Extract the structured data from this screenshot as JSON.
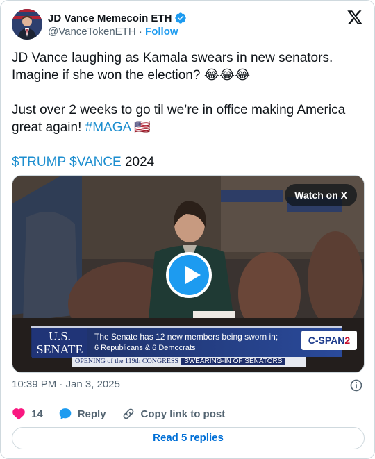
{
  "author": {
    "name": "JD Vance Memecoin ETH",
    "handle": "@VanceTokenETH",
    "separator": "·",
    "follow_label": "Follow"
  },
  "tweet": {
    "line1": "JD Vance laughing as Kamala swears in new senators. Imagine if she won the election? 😂😂😂",
    "line2_text": "Just over 2 weeks to go til we’re in office making America great again! ",
    "line2_hashtag": "#MAGA",
    "line2_flag": "🇺🇸",
    "line3_cashtag1": "$TRUMP",
    "line3_cashtag2": "$VANCE",
    "line3_year": "2024"
  },
  "media": {
    "watch_label": "Watch on X",
    "chyron_us": "U.S.",
    "chyron_senate": "SENATE",
    "chyron_line1": "The Senate has 12 new members being sworn in;",
    "chyron_line2": "6 Republicans & 6 Democrats",
    "network": "C-SPAN",
    "network_num": "2",
    "sub_left": "OPENING of the 119th CONGRESS",
    "sub_right": "SWEARING-IN OF SENATORS"
  },
  "meta": {
    "time": "10:39 PM",
    "separator": "·",
    "date": "Jan 3, 2025"
  },
  "actions": {
    "like_count": "14",
    "reply_label": "Reply",
    "copy_label": "Copy link to post"
  },
  "read_replies_label": "Read 5 replies",
  "colors": {
    "accent": "#1d9bf0",
    "like": "#f91880",
    "text": "#0f1419",
    "secondary": "#536471"
  }
}
